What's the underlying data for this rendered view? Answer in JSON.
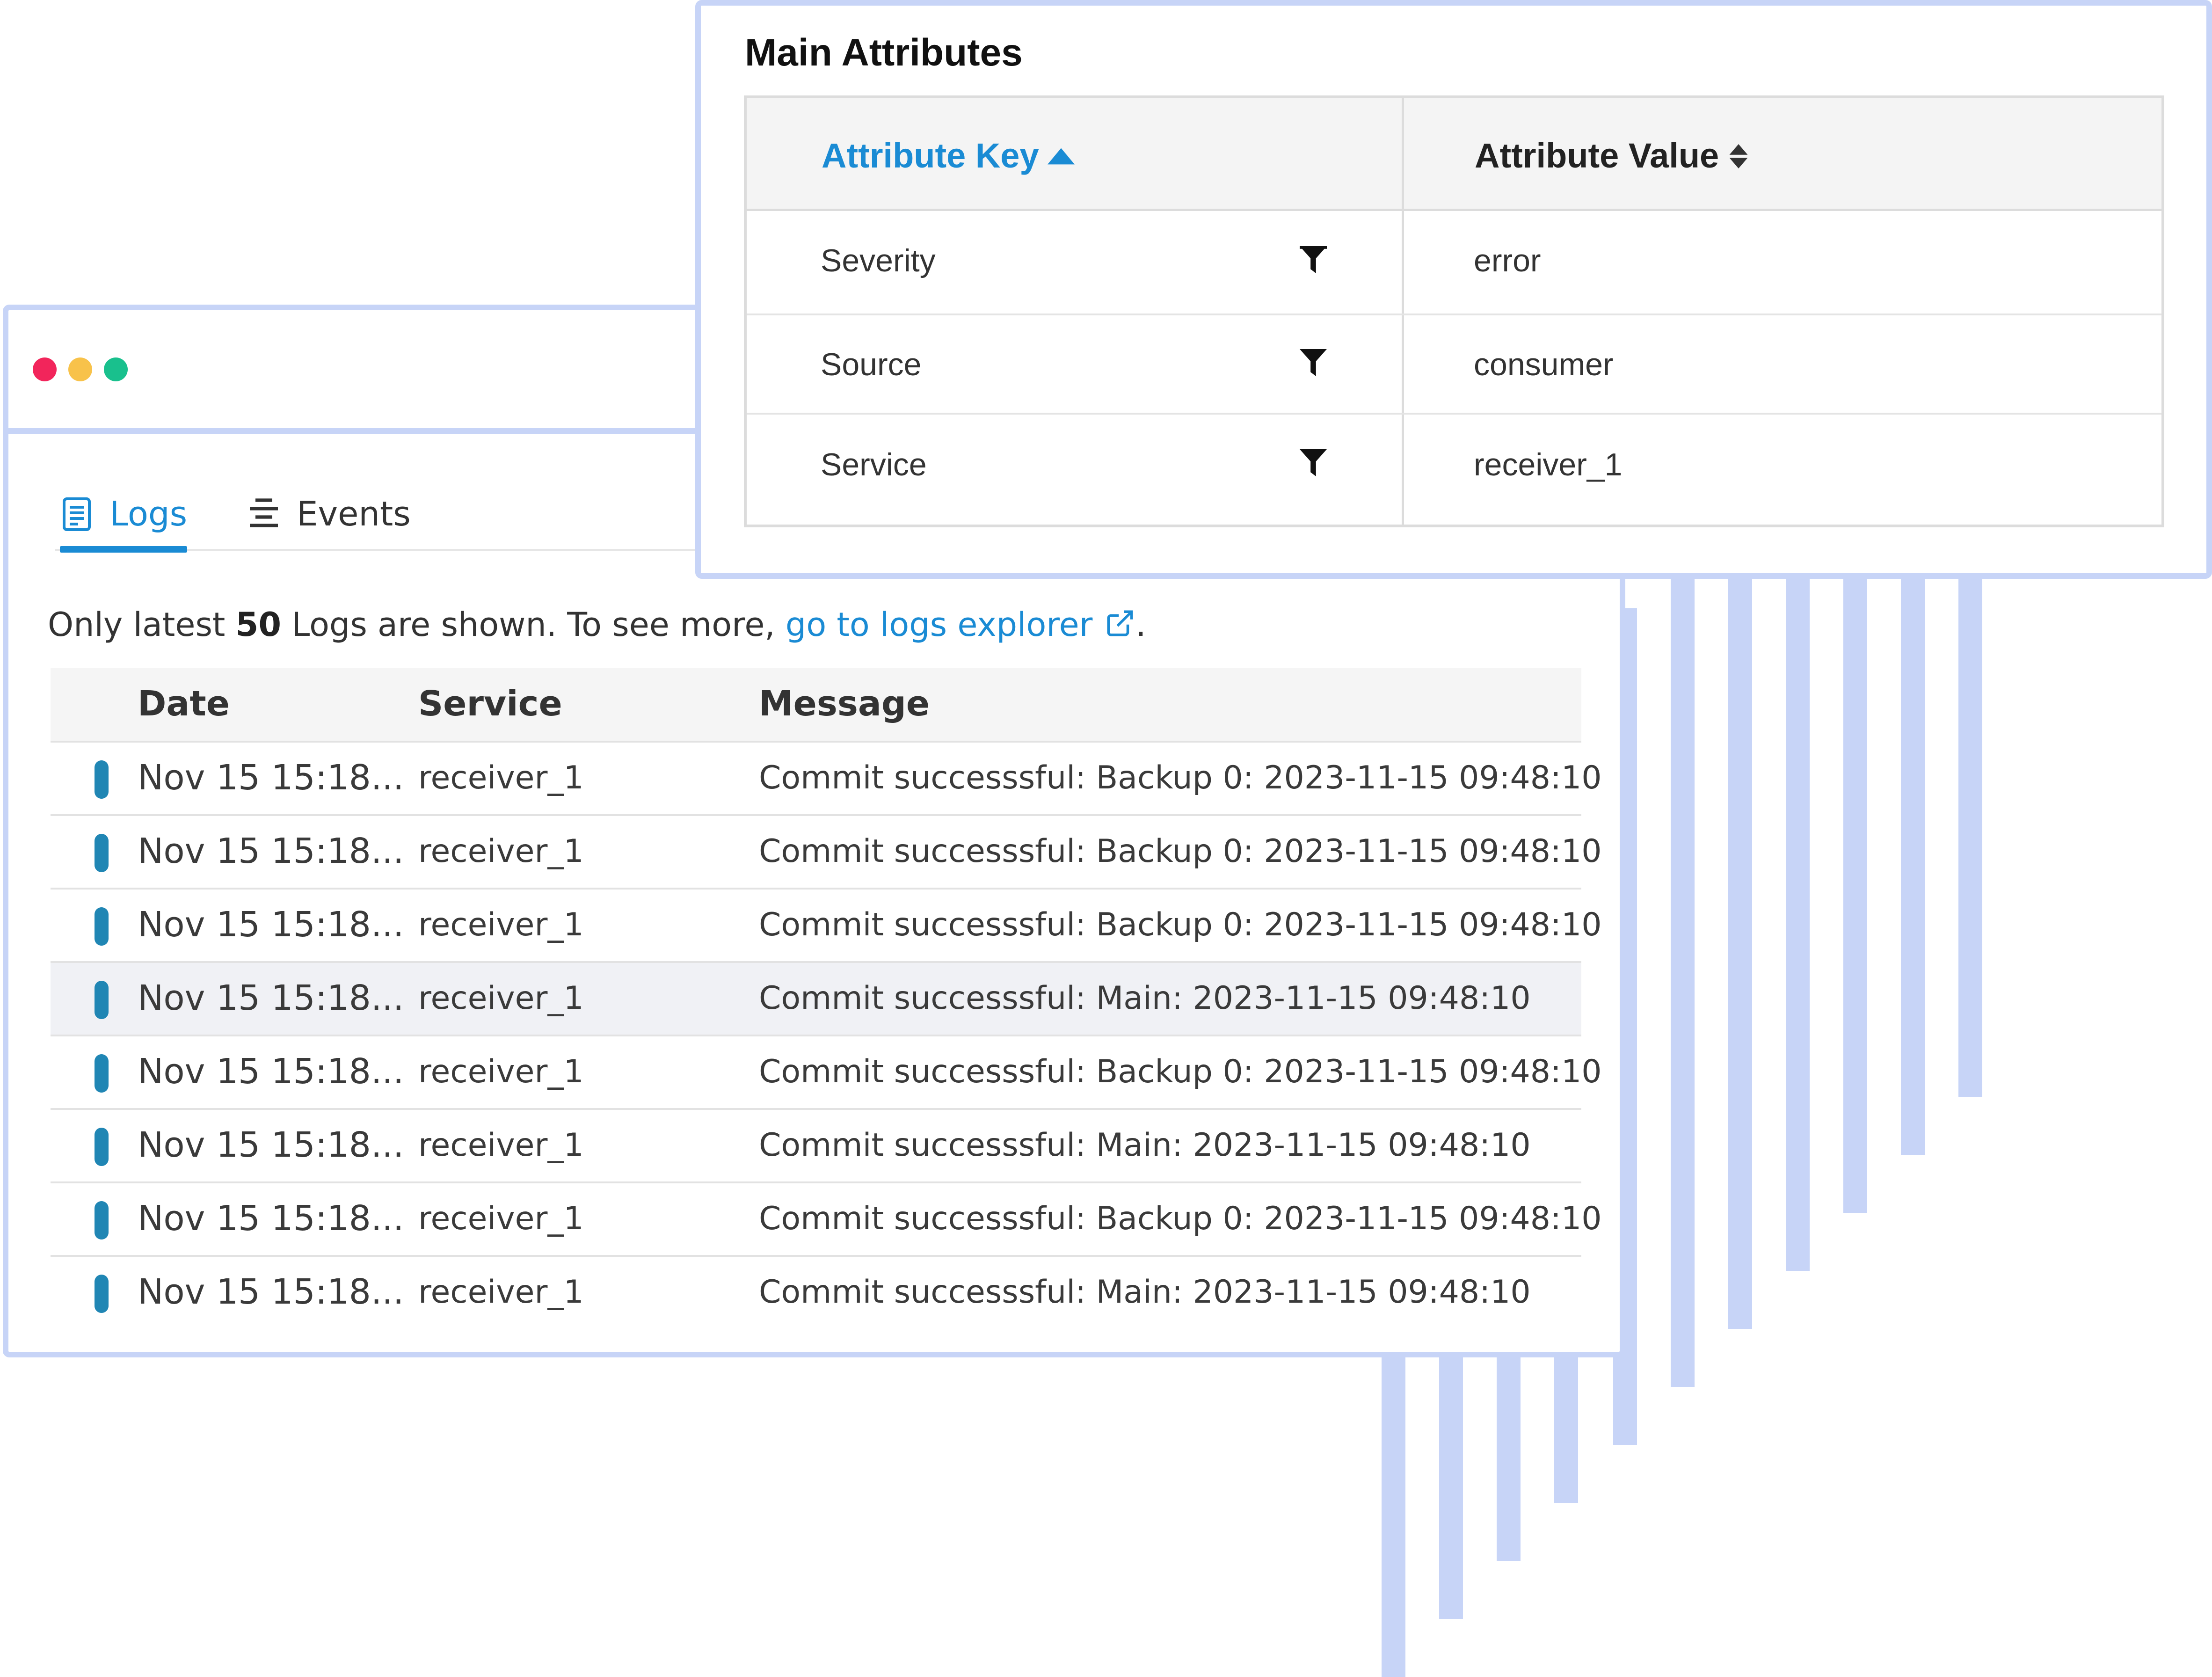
{
  "colors": {
    "accent": "#1a8bd4",
    "window_border": "#c7d4f7",
    "severity_marker": "#2086b4",
    "traffic_red": "#f2255b",
    "traffic_yellow": "#f8c24a",
    "traffic_green": "#19c08d"
  },
  "logs_panel": {
    "tabs": [
      {
        "label": "Logs",
        "icon": "document-icon",
        "active": true
      },
      {
        "label": "Events",
        "icon": "list-icon",
        "active": false
      }
    ],
    "notice": {
      "prefix": "Only latest ",
      "count": "50",
      "middle": " Logs are shown. To see more, ",
      "link": "go to logs explorer",
      "suffix": "."
    },
    "columns": [
      "Date",
      "Service",
      "Message"
    ],
    "rows": [
      {
        "date": "Nov 15 15:18...",
        "service": "receiver_1",
        "message": "Commit successsful: Backup 0: 2023-11-15 09:48:10"
      },
      {
        "date": "Nov 15 15:18...",
        "service": "receiver_1",
        "message": "Commit successsful: Backup 0: 2023-11-15 09:48:10"
      },
      {
        "date": "Nov 15 15:18...",
        "service": "receiver_1",
        "message": "Commit successsful: Backup 0: 2023-11-15 09:48:10"
      },
      {
        "date": "Nov 15 15:18...",
        "service": "receiver_1",
        "message": "Commit successsful: Main: 2023-11-15 09:48:10"
      },
      {
        "date": "Nov 15 15:18...",
        "service": "receiver_1",
        "message": "Commit successsful: Backup 0: 2023-11-15 09:48:10"
      },
      {
        "date": "Nov 15 15:18...",
        "service": "receiver_1",
        "message": "Commit successsful: Main: 2023-11-15 09:48:10"
      },
      {
        "date": "Nov 15 15:18...",
        "service": "receiver_1",
        "message": "Commit successsful: Backup 0: 2023-11-15 09:48:10"
      },
      {
        "date": "Nov 15 15:18...",
        "service": "receiver_1",
        "message": "Commit successsful: Main: 2023-11-15 09:48:10"
      }
    ]
  },
  "attributes_panel": {
    "title": "Main Attributes",
    "columns": {
      "key": "Attribute Key",
      "value": "Attribute Value"
    },
    "rows": [
      {
        "key": "Severity",
        "value": "error"
      },
      {
        "key": "Source",
        "value": "consumer"
      },
      {
        "key": "Service",
        "value": "receiver_1"
      }
    ]
  }
}
